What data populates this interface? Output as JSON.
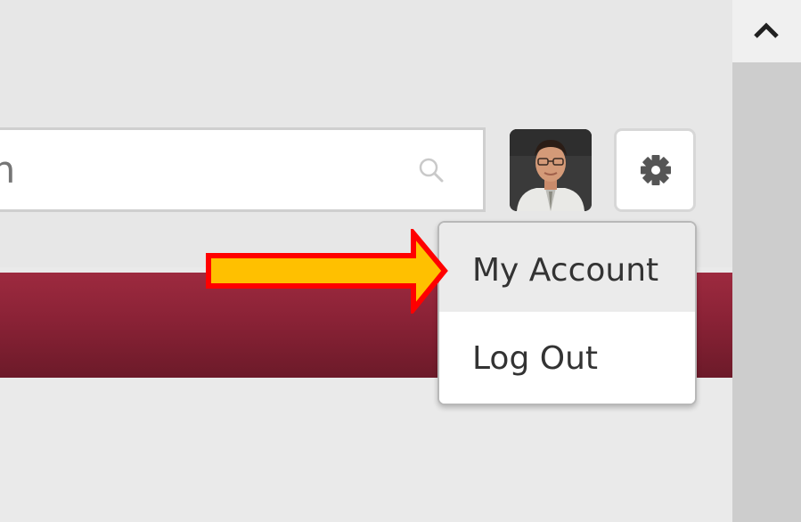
{
  "search": {
    "placeholder": "Search",
    "icon": "magnifier-icon"
  },
  "user_menu": {
    "avatar": "user-avatar-photo",
    "settings_icon": "gear-icon",
    "items": [
      {
        "label": "My Account",
        "highlighted": true
      },
      {
        "label": "Log Out",
        "highlighted": false
      }
    ]
  },
  "annotation": {
    "icon": "arrow-right-icon",
    "fill_color": "#ffc000",
    "outline_color": "#ff0000"
  },
  "banner": {
    "color_top": "#9d2a3f",
    "color_bottom": "#6c1a29"
  },
  "scrollbar": {
    "icon": "chevron-up-icon"
  }
}
